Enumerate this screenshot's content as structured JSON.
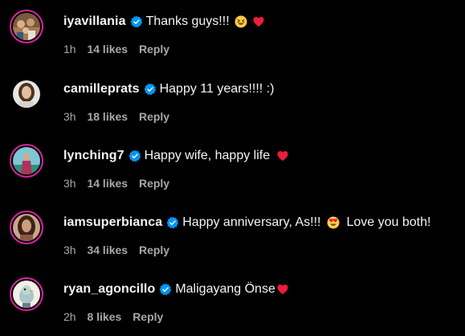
{
  "colors": {
    "background": "#000000",
    "text": "#f5f5f5",
    "meta": "#a8a8a8",
    "verified": "#0095f6",
    "heart": "#ed1c3c",
    "story_ring": "#d6249f"
  },
  "comments": [
    {
      "username": "iyavillania",
      "verified": true,
      "text_parts": [
        "Thanks guys!!!"
      ],
      "emojis": [
        "squinting-face-emoji",
        "red-heart-emoji"
      ],
      "time": "1h",
      "likes": "14 likes",
      "reply": "Reply",
      "avatar_ring": true
    },
    {
      "username": "camilleprats",
      "verified": true,
      "text_parts": [
        "Happy 11 years!!!! :)"
      ],
      "emojis": [],
      "time": "3h",
      "likes": "18 likes",
      "reply": "Reply",
      "avatar_ring": false
    },
    {
      "username": "lynching7",
      "verified": true,
      "text_parts": [
        "Happy wife, happy life"
      ],
      "emojis": [
        "red-heart-emoji"
      ],
      "time": "3h",
      "likes": "14 likes",
      "reply": "Reply",
      "avatar_ring": true
    },
    {
      "username": "iamsuperbianca",
      "verified": true,
      "text_parts": [
        "Happy anniversary, As!!!",
        "Love you both!"
      ],
      "emojis": [
        "heart-eyes-emoji"
      ],
      "time": "3h",
      "likes": "34 likes",
      "reply": "Reply",
      "avatar_ring": true
    },
    {
      "username": "ryan_agoncillo",
      "verified": true,
      "text_parts": [
        "Maligayang Önse"
      ],
      "emojis": [
        "red-heart-emoji"
      ],
      "time": "2h",
      "likes": "8 likes",
      "reply": "Reply",
      "avatar_ring": true
    }
  ]
}
